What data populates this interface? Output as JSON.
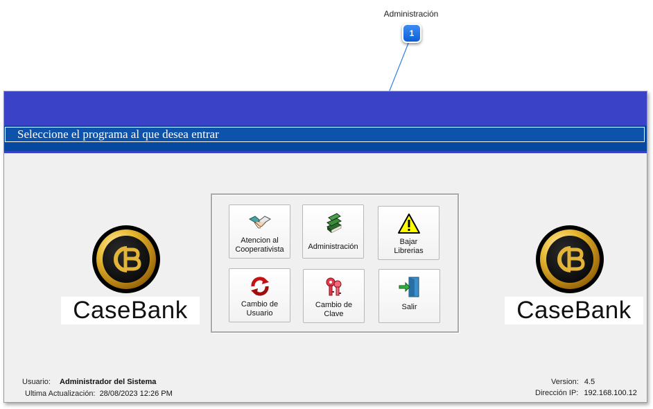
{
  "callout": {
    "label": "Administración",
    "badge": "1"
  },
  "window": {
    "title": "Seleccione el programa al que desea entrar",
    "logo_text": "CaseBank",
    "buttons": [
      {
        "label": "Atencion al\nCooperativista",
        "icon": "handshake-icon"
      },
      {
        "label": "Administración",
        "icon": "books-icon"
      },
      {
        "label": "Bajar\nLibrerias",
        "icon": "warning-icon"
      },
      {
        "label": "Cambio de\nUsuario",
        "icon": "refresh-arrows-icon"
      },
      {
        "label": "Cambio de\nClave",
        "icon": "keys-icon"
      },
      {
        "label": "Salir",
        "icon": "exit-door-icon"
      }
    ],
    "footer": {
      "user_label": "Usuario:",
      "user_value": "Administrador del Sistema",
      "update_label": "Ultima Actualización:",
      "update_value": "28/08/2023 12:26 PM",
      "version_label": "Version:",
      "version_value": "4.5",
      "ip_label": "Dirección IP:",
      "ip_value": "192.168.100.12"
    }
  },
  "colors": {
    "banner": "#3a43c8",
    "title_strip": "#0648a0",
    "badge": "#1a6fe8"
  }
}
